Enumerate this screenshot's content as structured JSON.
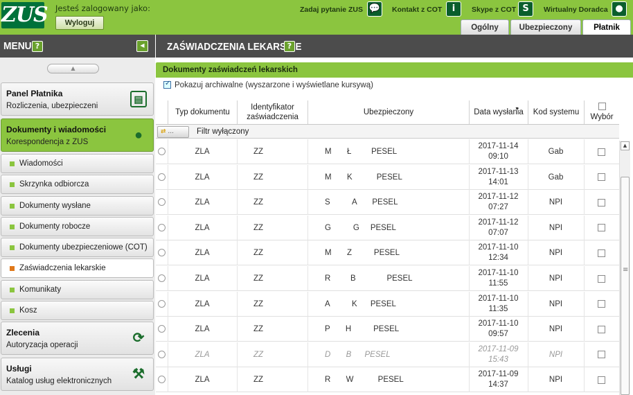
{
  "header": {
    "logo": "ZUS",
    "logged_in_label": "Jesteś zalogowany jako:",
    "logout_label": "Wyloguj",
    "links": [
      {
        "label": "Zadaj pytanie ZUS",
        "icon": "chat-icon"
      },
      {
        "label": "Kontakt z COT",
        "icon": "info-icon"
      },
      {
        "label": "Skype z COT",
        "icon": "skype-icon"
      },
      {
        "label": "Wirtualny Doradca",
        "icon": "user-icon"
      }
    ],
    "tabs": [
      "Ogólny",
      "Ubezpieczony",
      "Płatnik"
    ],
    "active_tab": "Płatnik"
  },
  "sidebar": {
    "title": "MENU",
    "help": "?",
    "sections": [
      {
        "title": "Panel Płatnika",
        "subtitle": "Rozliczenia, ubezpieczeni",
        "icon": "document-stack-icon"
      },
      {
        "title": "Dokumenty i wiadomości",
        "subtitle": "Korespondencja z ZUS",
        "icon": "speech-bubble-icon"
      },
      {
        "title": "Zlecenia",
        "subtitle": "Autoryzacja operacji",
        "icon": "refresh-icon"
      },
      {
        "title": "Usługi",
        "subtitle": "Katalog usług elektronicznych",
        "icon": "tools-icon"
      }
    ],
    "items": [
      "Wiadomości",
      "Skrzynka odbiorcza",
      "Dokumenty wysłane",
      "Dokumenty robocze",
      "Dokumenty ubezpieczeniowe (COT)",
      "Zaświadczenia lekarskie",
      "Komunikaty",
      "Kosz"
    ],
    "active_item": "Zaświadczenia lekarskie"
  },
  "main": {
    "title": "ZAŚWIADCZENIA LEKARSKIE",
    "help": "?",
    "section_title": "Dokumenty zaświadczeń lekarskich",
    "archive_label": "Pokazuj archiwalne (wyszarzone i wyświetlane kursywą)",
    "archive_checked": true,
    "columns": [
      "Typ dokumentu",
      "Identyfikator zaświadczenia",
      "Ubezpieczony",
      "Data wysłania",
      "Kod systemu",
      "Wybór"
    ],
    "filter_button": "...",
    "filter_label": "Filtr wyłączony",
    "rows": [
      {
        "typ": "ZLA",
        "id": "ZZ",
        "ubezp": "M       Ł         PESEL",
        "date": "2017-11-14",
        "time": "09:10",
        "kod": "Gab",
        "arch": false
      },
      {
        "typ": "ZLA",
        "id": "ZZ",
        "ubezp": "M       K           PESEL",
        "date": "2017-11-13",
        "time": "14:01",
        "kod": "Gab",
        "arch": false
      },
      {
        "typ": "ZLA",
        "id": "ZZ",
        "ubezp": "S          A       PESEL",
        "date": "2017-11-12",
        "time": "07:27",
        "kod": "NPI",
        "arch": false
      },
      {
        "typ": "ZLA",
        "id": "ZZ",
        "ubezp": "G          G     PESEL",
        "date": "2017-11-12",
        "time": "07:07",
        "kod": "NPI",
        "arch": false
      },
      {
        "typ": "ZLA",
        "id": "ZZ",
        "ubezp": "M       Z          PESEL",
        "date": "2017-11-10",
        "time": "12:34",
        "kod": "NPI",
        "arch": false
      },
      {
        "typ": "ZLA",
        "id": "ZZ",
        "ubezp": "R         B              PESEL",
        "date": "2017-11-10",
        "time": "11:55",
        "kod": "NPI",
        "arch": false
      },
      {
        "typ": "ZLA",
        "id": "ZZ",
        "ubezp": "A          K      PESEL",
        "date": "2017-11-10",
        "time": "11:35",
        "kod": "NPI",
        "arch": false
      },
      {
        "typ": "ZLA",
        "id": "ZZ",
        "ubezp": "P       H          PESEL",
        "date": "2017-11-10",
        "time": "09:57",
        "kod": "NPI",
        "arch": false
      },
      {
        "typ": "ZLA",
        "id": "ZZ",
        "ubezp": "D       B      PESEL",
        "date": "2017-11-09",
        "time": "15:43",
        "kod": "NPI",
        "arch": true
      },
      {
        "typ": "ZLA",
        "id": "ZZ",
        "ubezp": "R       W           PESEL",
        "date": "2017-11-09",
        "time": "14:37",
        "kod": "NPI",
        "arch": false
      }
    ]
  }
}
